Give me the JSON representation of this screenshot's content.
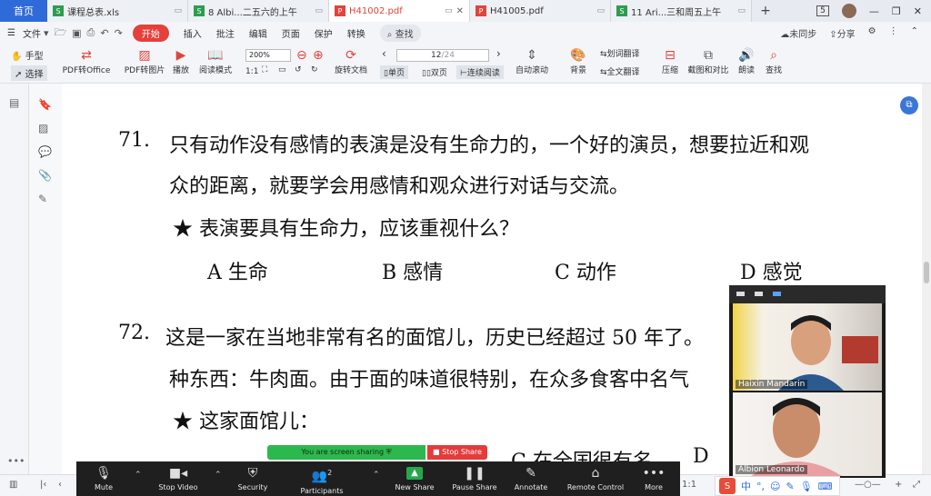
{
  "tabs": {
    "home": "首页",
    "items": [
      {
        "title": "课程总表.xls",
        "icon_color": "#2e9c4f",
        "icon": "S"
      },
      {
        "title": "8 Albi...二五六的上午",
        "icon_color": "#2e9c4f",
        "icon": "S"
      },
      {
        "title": "H41002.pdf",
        "icon_color": "#e0443c",
        "icon": "P"
      },
      {
        "title": "H41005.pdf",
        "icon_color": "#e0443c",
        "icon": "P"
      },
      {
        "title": "11 Ari...三和周五上午",
        "icon_color": "#2e9c4f",
        "icon": "S"
      }
    ],
    "add": "+",
    "badge": "5"
  },
  "menu": {
    "file": "文件",
    "start": "开始",
    "items": [
      "插入",
      "批注",
      "编辑",
      "页面",
      "保护",
      "转换"
    ],
    "search": "查找",
    "unsynced": "未同步",
    "share": "分享"
  },
  "toolbar": {
    "hand": "手型",
    "select": "选择",
    "pdf_to_office": "PDF转Office",
    "pdf_to_image": "PDF转图片",
    "play": "播放",
    "read_mode": "阅读模式",
    "zoom": "200%",
    "rotate": "旋转文档",
    "page_current": "12",
    "page_total": "/24",
    "single": "单页",
    "double": "双页",
    "continuous": "连续阅读",
    "autoscroll": "自动滚动",
    "background": "背景",
    "translate_word": "划词翻译",
    "translate_full": "全文翻译",
    "compress": "压缩",
    "compare": "截图和对比",
    "read_aloud": "朗读",
    "find": "查找"
  },
  "doc": {
    "q71_num": "71.",
    "q71_line1": "只有动作没有感情的表演是没有生命力的，一个好的演员，想要拉近和观",
    "q71_line2": "众的距离，就要学会用感情和观众进行对话与交流。",
    "q71_ask": "★ 表演要具有生命力，应该重视什么？",
    "q71_options": [
      "A 生命",
      "B 感情",
      "C 动作",
      "D 感觉"
    ],
    "q72_num": "72.",
    "q72_line1": "这是一家在当地非常有名的面馆儿，历史已经超过 50 年了。",
    "q72_line2": "种东西：牛肉面。由于面的味道很特别，在众多食客中名气",
    "q72_ask": "★ 这家面馆儿：",
    "q72_option_c": "C 在全国很有名",
    "q72_option_d": "D"
  },
  "video": {
    "participant1": "Haixin Mandarin",
    "participant2": "Albion Leonardo"
  },
  "zoom_bar": {
    "sharing_notice": "You are screen sharing",
    "stop_share": "Stop Share",
    "buttons": [
      "Mute",
      "Stop Video",
      "Security",
      "Participants",
      "New Share",
      "Pause Share",
      "Annotate",
      "Remote Control",
      "More"
    ],
    "participants_count": "2"
  },
  "status": {
    "ime_char": "中"
  }
}
